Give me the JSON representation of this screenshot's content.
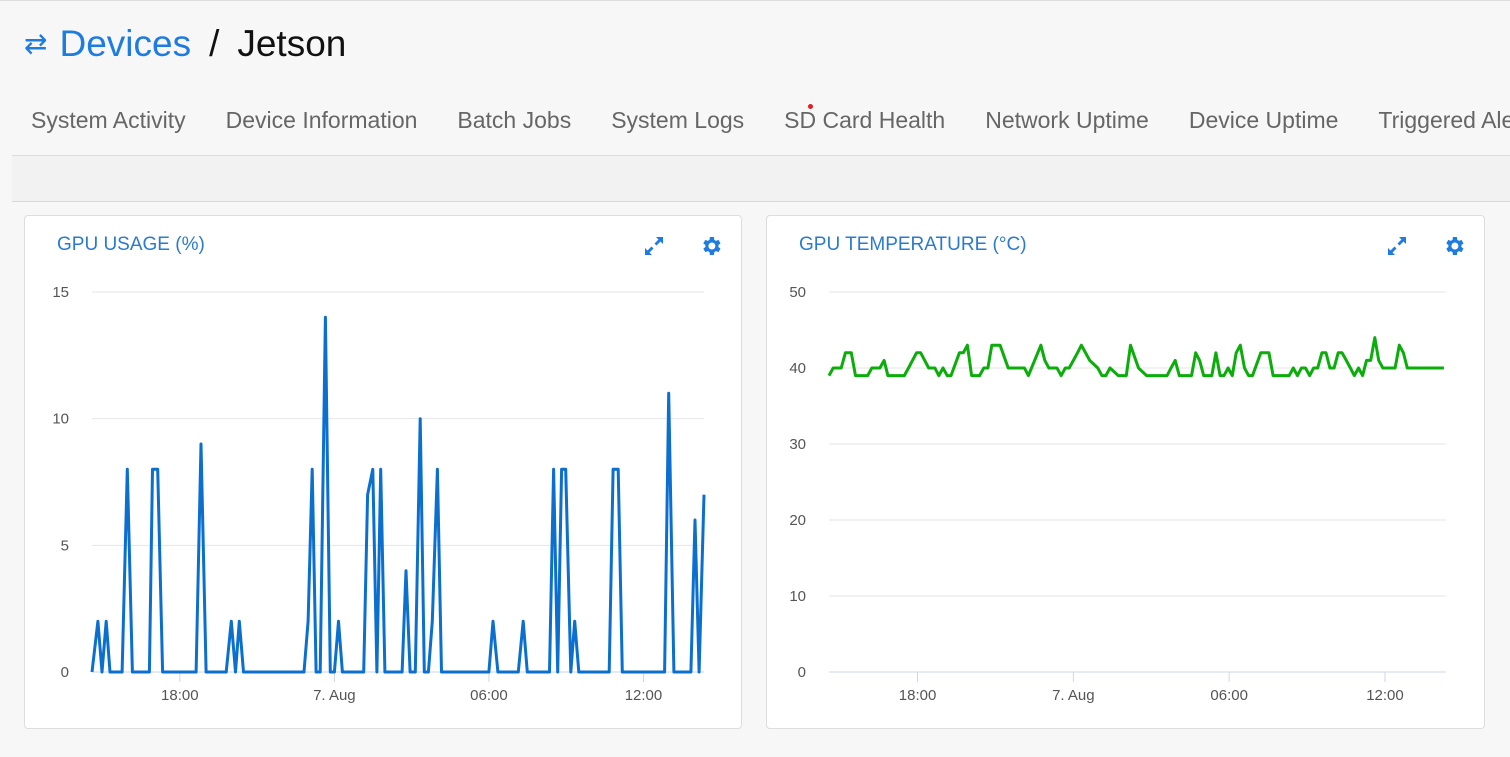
{
  "header": {
    "icon": "swap-arrows-icon",
    "parent": "Devices",
    "separator": "/",
    "device": "Jetson"
  },
  "tabs": [
    {
      "label": "System Activity"
    },
    {
      "label": "Device Information"
    },
    {
      "label": "Batch Jobs"
    },
    {
      "label": "System Logs"
    },
    {
      "label": "SD Card Health",
      "alert_dot": true
    },
    {
      "label": "Network Uptime"
    },
    {
      "label": "Device Uptime"
    },
    {
      "label": "Triggered Alerts"
    }
  ],
  "colors": {
    "accent": "#1e7be0",
    "gpu_line": "#0b6fcf",
    "temp_line": "#0aad0a",
    "alert_dot": "#e02020"
  },
  "chart_data": [
    {
      "type": "line",
      "title": "GPU USAGE (%)",
      "xlabel": "",
      "ylabel": "",
      "ylim": [
        0,
        15
      ],
      "yticks": [
        0,
        5,
        10,
        15
      ],
      "x_unit": "hours relative to 7. Aug 00:00",
      "xlim": [
        -9.41,
        14.35
      ],
      "xticks": [
        {
          "value": -6,
          "label": "18:00"
        },
        {
          "value": 0,
          "label": "7. Aug"
        },
        {
          "value": 6,
          "label": "06:00"
        },
        {
          "value": 12,
          "label": "12:00"
        }
      ],
      "grid": true,
      "legend": "none",
      "series": [
        {
          "name": "GPU Usage",
          "x": [
            -9.41,
            -9.18,
            -9.02,
            -8.86,
            -8.71,
            -8.24,
            -8.04,
            -7.84,
            -7.18,
            -7.06,
            -6.86,
            -6.67,
            -5.37,
            -5.18,
            -4.98,
            -4.2,
            -4.0,
            -3.84,
            -3.69,
            -3.53,
            -1.18,
            -1.02,
            -0.86,
            -0.71,
            -0.55,
            -0.35,
            -0.16,
            0.0,
            0.16,
            0.31,
            1.14,
            1.29,
            1.49,
            1.65,
            1.8,
            1.96,
            2.63,
            2.78,
            2.94,
            3.14,
            3.33,
            3.49,
            3.65,
            3.8,
            4.0,
            4.16,
            6.0,
            6.16,
            6.35,
            7.14,
            7.33,
            7.49,
            8.35,
            8.51,
            8.67,
            8.82,
            8.98,
            9.18,
            9.33,
            9.49,
            10.67,
            10.82,
            11.02,
            11.18,
            12.82,
            12.98,
            13.18,
            13.84,
            14.0,
            14.16,
            14.35
          ],
          "values": [
            0,
            2,
            0,
            2,
            0,
            0,
            8,
            0,
            0,
            8,
            8,
            0,
            0,
            9,
            0,
            0,
            2,
            0,
            2,
            0,
            0,
            2,
            8,
            0,
            0,
            14,
            0,
            0,
            2,
            0,
            0,
            7,
            8,
            0,
            8,
            0,
            0,
            4,
            0,
            0,
            10,
            0,
            0,
            2,
            8,
            0,
            0,
            2,
            0,
            0,
            2,
            0,
            0,
            8,
            0,
            8,
            8,
            0,
            2,
            0,
            0,
            8,
            8,
            0,
            0,
            11,
            0,
            0,
            6,
            0,
            7
          ]
        }
      ]
    },
    {
      "type": "line",
      "title": "GPU TEMPERATURE (°C)",
      "xlabel": "",
      "ylabel": "",
      "ylim": [
        0,
        50
      ],
      "yticks": [
        0,
        10,
        20,
        30,
        40,
        50
      ],
      "x_unit": "hours relative to 7. Aug 00:00",
      "xlim": [
        -9.41,
        14.35
      ],
      "xticks": [
        {
          "value": -6,
          "label": "18:00"
        },
        {
          "value": 0,
          "label": "7. Aug"
        },
        {
          "value": 6,
          "label": "06:00"
        },
        {
          "value": 12,
          "label": "12:00"
        }
      ],
      "grid": true,
      "legend": "none",
      "series": [
        {
          "name": "GPU Temperature",
          "x": [
            -9.41,
            -9.25,
            -8.94,
            -8.78,
            -8.55,
            -8.39,
            -7.92,
            -7.76,
            -7.45,
            -7.29,
            -7.14,
            -6.82,
            -6.51,
            -6.35,
            -6.04,
            -5.88,
            -5.57,
            -5.33,
            -5.18,
            -5.02,
            -4.86,
            -4.71,
            -4.39,
            -4.24,
            -4.08,
            -3.92,
            -3.61,
            -3.45,
            -3.29,
            -3.14,
            -2.82,
            -2.51,
            -2.35,
            -1.88,
            -1.73,
            -1.25,
            -1.1,
            -0.94,
            -0.63,
            -0.47,
            -0.31,
            -0.16,
            0.0,
            0.16,
            0.31,
            0.63,
            0.94,
            1.1,
            1.25,
            1.41,
            1.73,
            1.88,
            2.04,
            2.2,
            2.51,
            2.82,
            3.14,
            3.29,
            3.45,
            3.61,
            3.76,
            3.92,
            4.08,
            4.24,
            4.39,
            4.55,
            4.71,
            4.86,
            5.02,
            5.18,
            5.33,
            5.49,
            5.65,
            5.8,
            5.96,
            6.12,
            6.27,
            6.43,
            6.59,
            6.75,
            6.9,
            7.22,
            7.53,
            7.69,
            7.84,
            8.0,
            8.16,
            8.31,
            8.47,
            8.63,
            8.78,
            8.94,
            9.1,
            9.25,
            9.41,
            9.57,
            9.73,
            9.88,
            10.04,
            10.2,
            10.35,
            10.51,
            10.67,
            10.82,
            10.98,
            11.14,
            11.29,
            11.45,
            11.61,
            11.76,
            11.92,
            12.08,
            12.24,
            12.39,
            12.55,
            12.71,
            12.86,
            13.02,
            13.18,
            13.33,
            13.49,
            13.65,
            13.8,
            13.96,
            14.12,
            14.27
          ],
          "values": [
            39,
            40,
            40,
            42,
            42,
            39,
            39,
            40,
            40,
            41,
            39,
            39,
            39,
            40,
            42,
            42,
            40,
            40,
            39,
            40,
            39,
            39,
            42,
            42,
            43,
            39,
            39,
            40,
            40,
            43,
            43,
            40,
            40,
            40,
            39,
            43,
            41,
            40,
            40,
            39,
            40,
            40,
            41,
            42,
            43,
            41,
            40,
            39,
            39,
            40,
            39,
            39,
            39,
            43,
            40,
            39,
            39,
            39,
            39,
            39,
            40,
            41,
            39,
            39,
            39,
            39,
            42,
            41,
            39,
            39,
            39,
            42,
            39,
            39,
            40,
            39,
            42,
            43,
            40,
            39,
            39,
            42,
            42,
            39,
            39,
            39,
            39,
            39,
            40,
            39,
            40,
            40,
            39,
            40,
            40,
            42,
            42,
            40,
            40,
            42,
            42,
            41,
            40,
            39,
            40,
            39,
            41,
            41,
            44,
            41,
            40,
            40,
            40,
            40,
            43,
            42,
            40,
            40,
            40,
            40,
            40,
            40,
            40,
            40,
            40,
            40
          ]
        }
      ]
    }
  ],
  "cards": [
    {
      "expand_icon": "expand-icon",
      "settings_icon": "gear-icon"
    },
    {
      "expand_icon": "expand-icon",
      "settings_icon": "gear-icon"
    }
  ]
}
